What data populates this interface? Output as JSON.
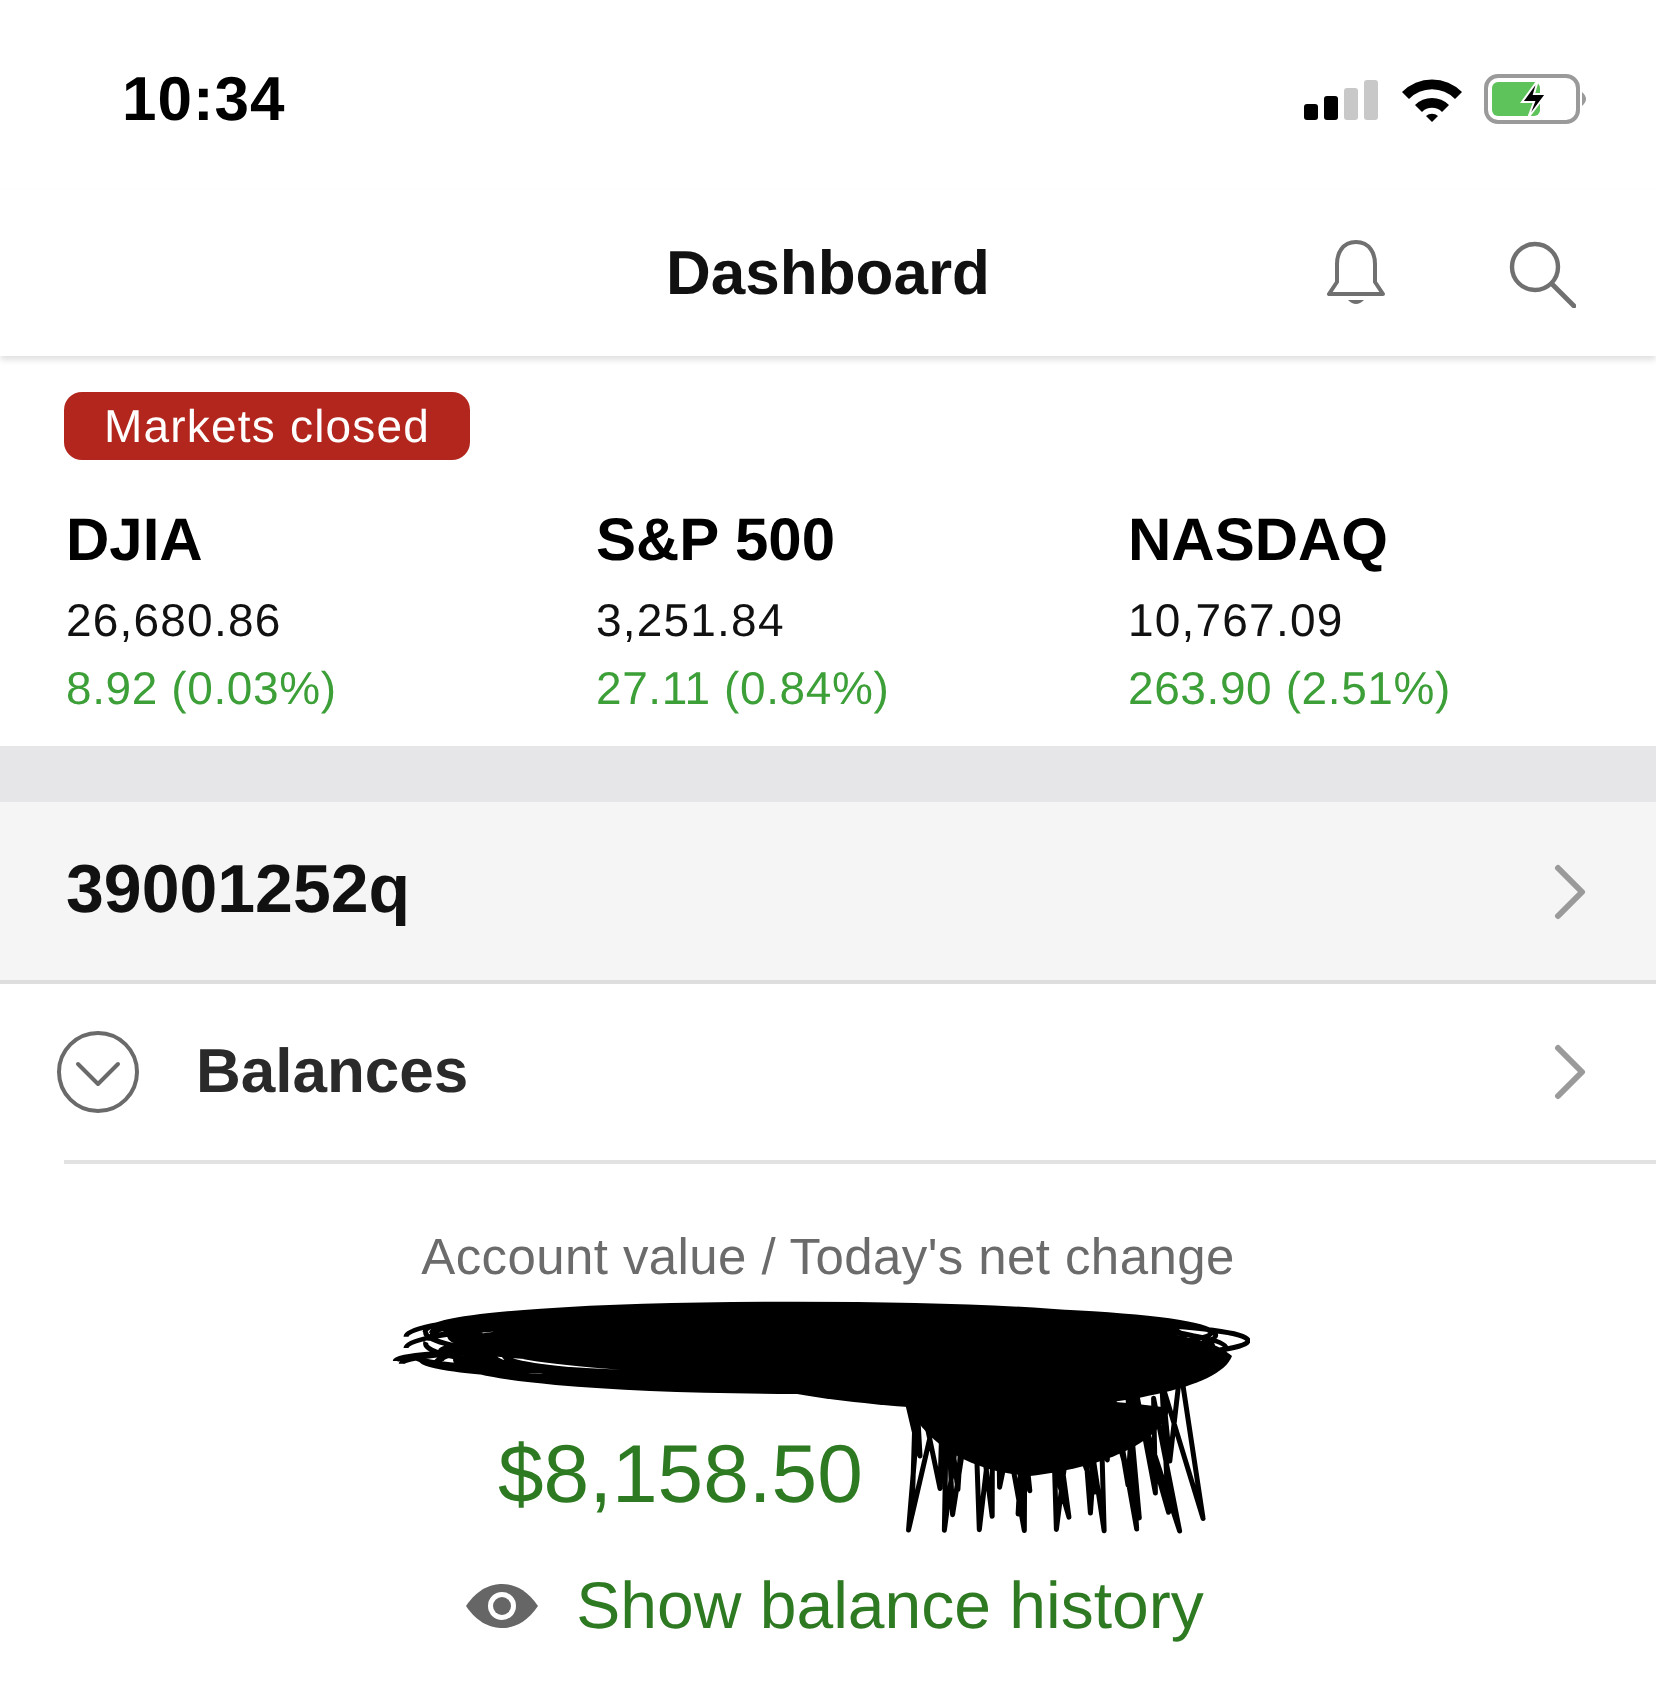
{
  "status_bar": {
    "time": "10:34"
  },
  "nav": {
    "title": "Dashboard"
  },
  "market": {
    "status": "Markets closed",
    "indices": [
      {
        "name": "DJIA",
        "value": "26,680.86",
        "change": "8.92 (0.03%)"
      },
      {
        "name": "S&P 500",
        "value": "3,251.84",
        "change": "27.11 (0.84%)"
      },
      {
        "name": "NASDAQ",
        "value": "10,767.09",
        "change": "263.90 (2.51%)"
      }
    ]
  },
  "account": {
    "number": "39001252q"
  },
  "balances": {
    "title": "Balances",
    "expanded": true,
    "label": "Account value / Today's net change",
    "value": "$8,158.50",
    "history_link": "Show balance history"
  }
}
